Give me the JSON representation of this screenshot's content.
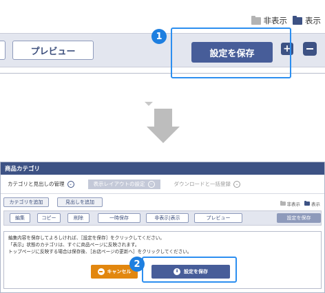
{
  "zoom": {
    "legend": {
      "hidden_label": "非表示",
      "shown_label": "表示"
    },
    "preview_label": "プレビュー",
    "save_label": "設定を保存",
    "plus_label": "+",
    "badge": "1"
  },
  "app": {
    "title": "商品カテゴリ",
    "tabs": [
      {
        "label": "カテゴリと見出しの管理"
      },
      {
        "label": "表示レイアウトの設定"
      },
      {
        "label": "ダウンロードと一括登録"
      }
    ],
    "actions": {
      "add_category": "カテゴリを追加",
      "add_heading": "見出しを追加"
    },
    "legend": {
      "hidden_label": "非表示",
      "shown_label": "表示"
    },
    "toolbar": {
      "edit": "編集",
      "copy": "コピー",
      "delete": "削除",
      "temp_save": "一時保存",
      "toggle_visibility": "非表示|表示",
      "preview": "プレビュー",
      "save": "設定を保存"
    },
    "message": {
      "line1": "編集内容を保存してよろしければ、［設定を保存］をクリックしてください。",
      "line2": "「表示」状態のカテゴリは、すぐに商品ページに反映されます。",
      "line3": "トップページに反映する場合は保存後、［お店ページの更新へ］をクリックしてください。"
    },
    "cancel_label": "キャンセル",
    "save_label": "設定を保存",
    "badge": "2"
  },
  "colors": {
    "navy": "#3d5284",
    "callout": "#2b8ef0",
    "cancel": "#e2870f"
  }
}
